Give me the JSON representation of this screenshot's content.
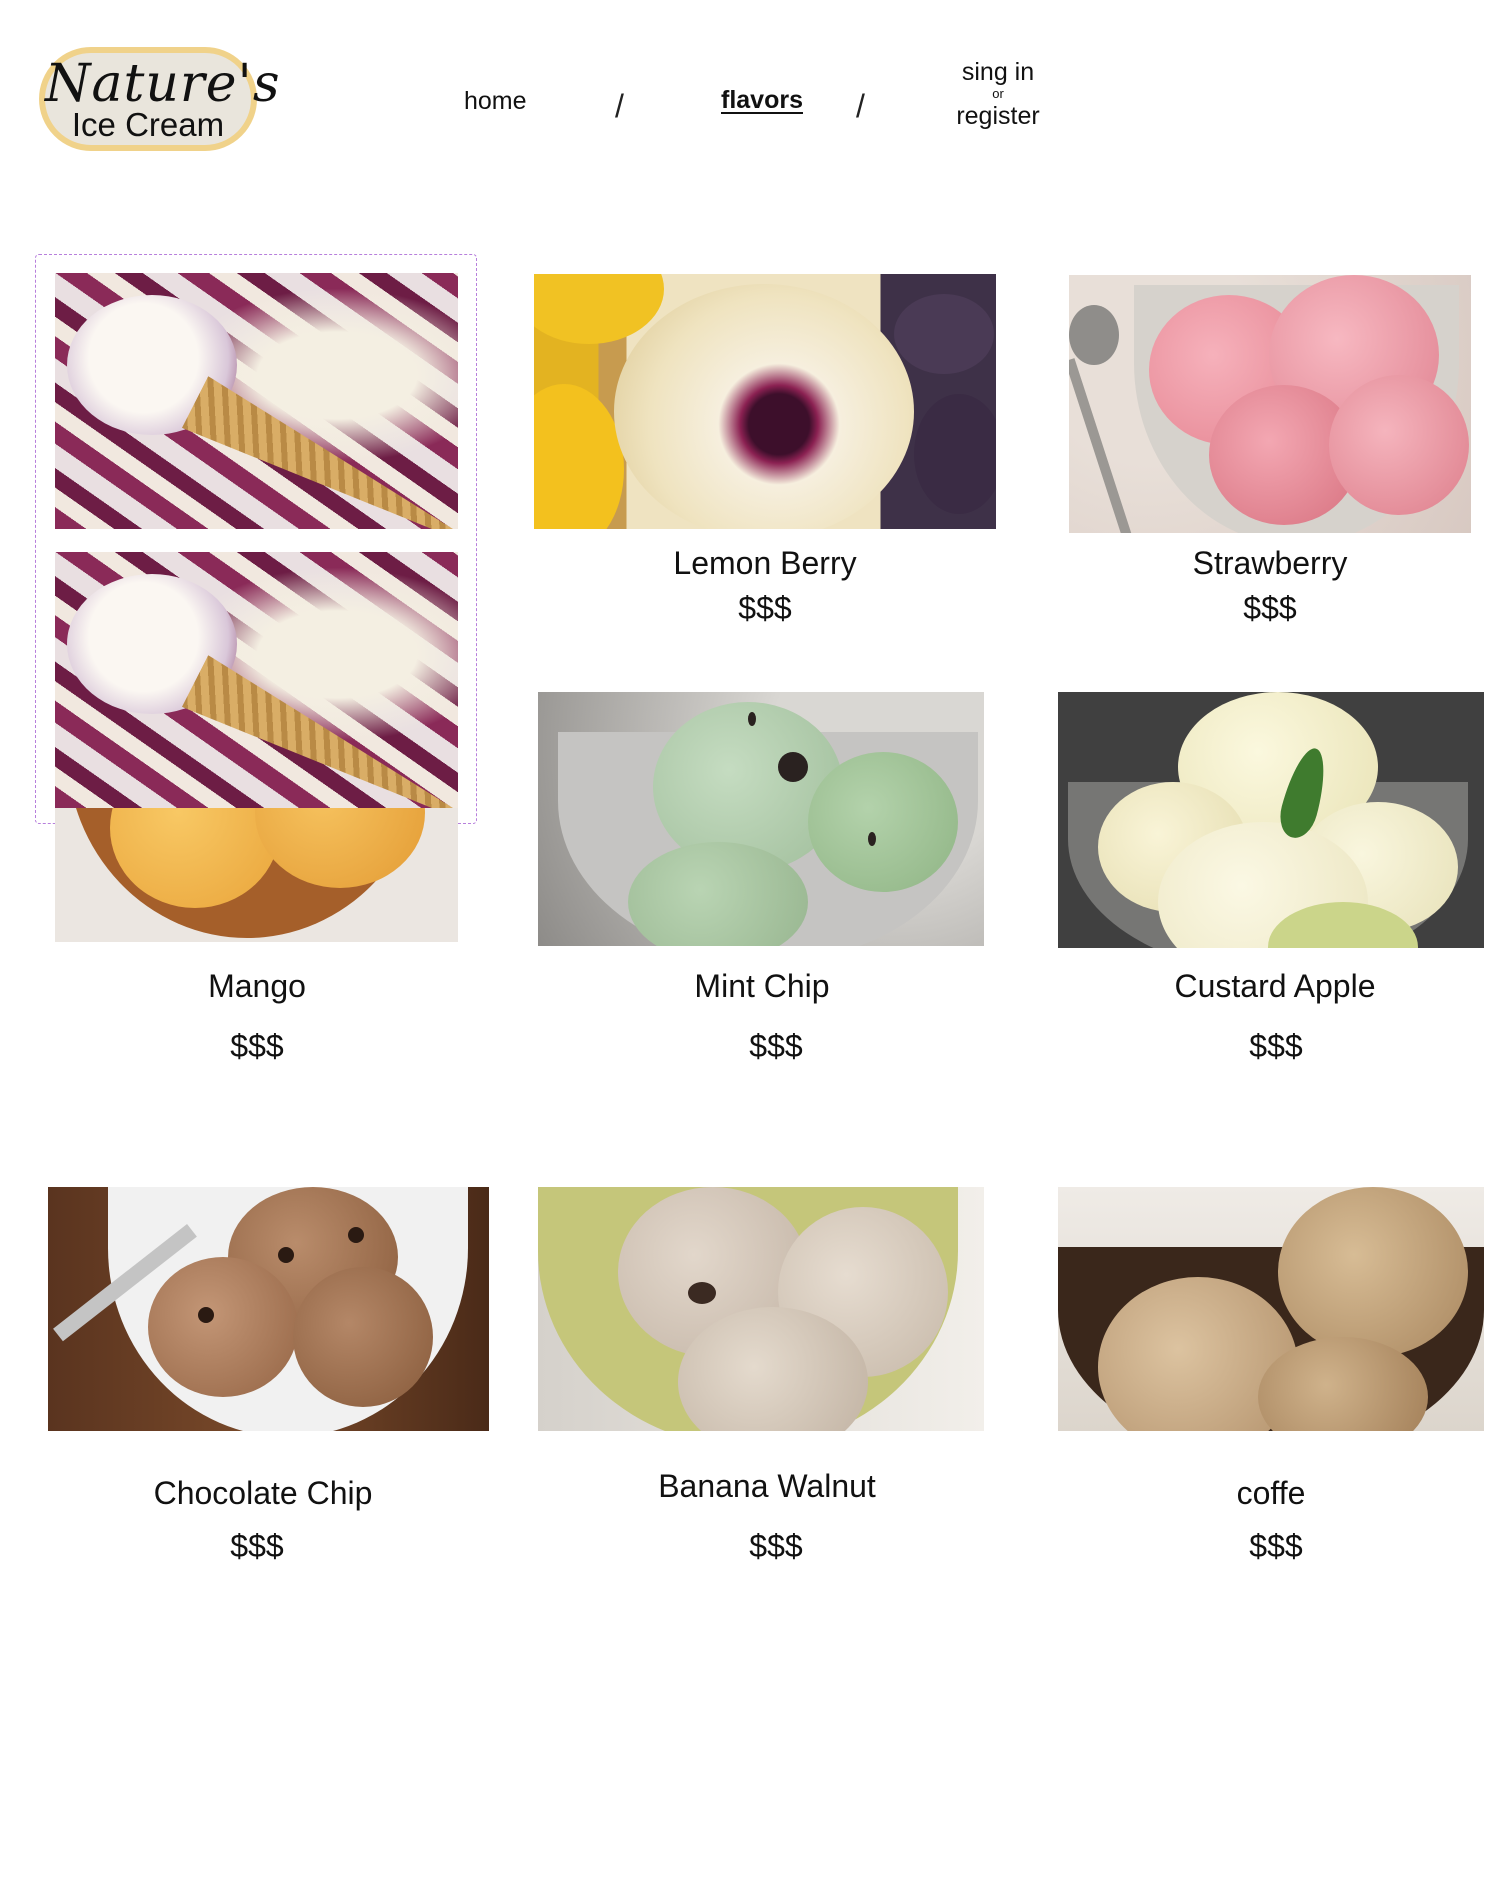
{
  "header": {
    "logo_brand": "Nature's",
    "logo_sub": "Ice Cream",
    "nav": {
      "home": "home",
      "separator": "/",
      "flavors": "flavors",
      "signin": "sing in",
      "or": "or",
      "register": "register"
    }
  },
  "products": [
    {
      "name": "Lemon Berry",
      "price": "$$$"
    },
    {
      "name": "Strawberry",
      "price": "$$$"
    },
    {
      "name": "Mango",
      "price": "$$$"
    },
    {
      "name": "Mint Chip",
      "price": "$$$"
    },
    {
      "name": "Custard Apple",
      "price": "$$$"
    },
    {
      "name": "Chocolate Chip",
      "price": "$$$"
    },
    {
      "name": "Banana Walnut",
      "price": "$$$"
    },
    {
      "name": "coffe",
      "price": "$$$"
    }
  ],
  "colors": {
    "logo_border": "#f0d28a",
    "logo_fill": "#e9e5dc",
    "selection_outline": "#b77fdc"
  }
}
